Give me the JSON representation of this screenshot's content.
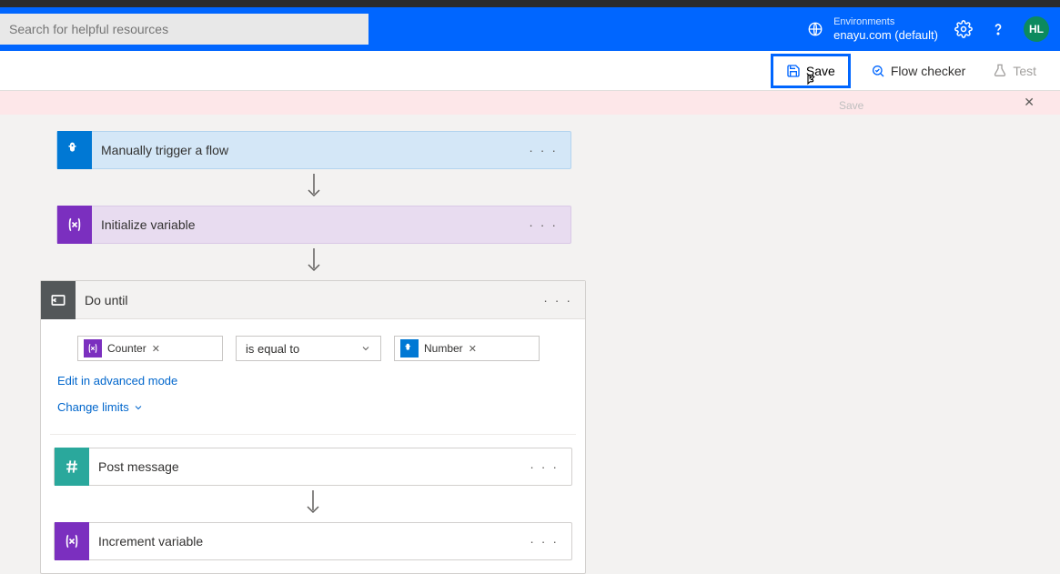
{
  "search": {
    "placeholder": "Search for helpful resources"
  },
  "environment": {
    "label": "Environments",
    "value": "enayu.com (default)"
  },
  "avatar": {
    "initials": "HL"
  },
  "toolbar": {
    "save": "Save",
    "flow_checker": "Flow checker",
    "test": "Test",
    "save_tooltip": "Save"
  },
  "steps": {
    "trigger": "Manually trigger a flow",
    "init_var": "Initialize variable",
    "do_until": "Do until",
    "post_msg": "Post message",
    "inc_var": "Increment variable"
  },
  "condition": {
    "left_token": "Counter",
    "operator": "is equal to",
    "right_token": "Number"
  },
  "links": {
    "edit_advanced": "Edit in advanced mode",
    "change_limits": "Change limits"
  }
}
